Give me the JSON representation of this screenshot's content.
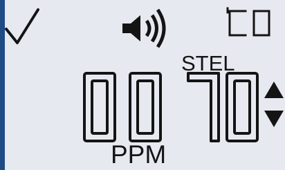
{
  "display": {
    "status_icon": "checkmark-icon",
    "sound_icon": "speaker-icon",
    "gas_label": "CO",
    "reading": "0070",
    "mode_label": "STEL",
    "unit": "PPM",
    "trend_icon": "up-down-arrows-icon",
    "colors": {
      "bezel": "#1f4a86",
      "lcd_background": "#e6e9f0",
      "segment": "#141414"
    }
  }
}
